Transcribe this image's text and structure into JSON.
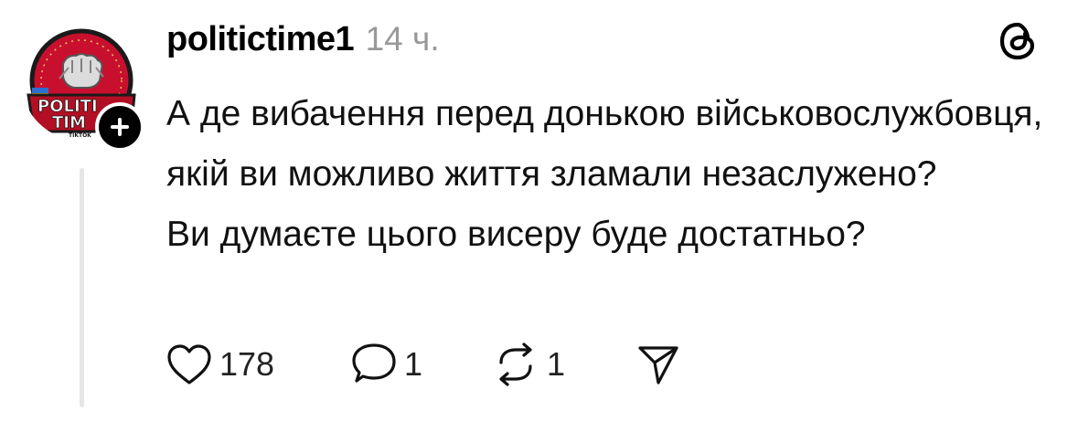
{
  "post": {
    "username": "politictime1",
    "timestamp": "14 ч.",
    "avatar_text": [
      "POLITI",
      "TIM",
      "TIKTOK"
    ],
    "paragraphs": [
      "А де вибачення перед донькою військовослужбовця, якій ви можливо життя зламали незаслужено?",
      "Ви думаєте цього висеру буде достатньо?"
    ],
    "actions": {
      "likes": "178",
      "replies": "1",
      "reposts": "1"
    }
  },
  "icons": {
    "header": "threads-logo-icon",
    "like": "heart-icon",
    "reply": "speech-bubble-icon",
    "repost": "repost-icon",
    "share": "send-icon"
  },
  "colors": {
    "text": "#000000",
    "secondary": "#999999",
    "thread_line": "#e6e6e6"
  }
}
